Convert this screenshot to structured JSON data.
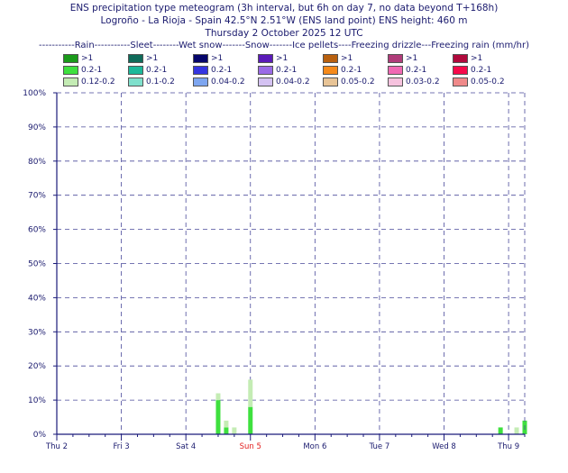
{
  "titles": {
    "line1": "ENS precipitation type meteogram (3h interval, but 6h on day 7, no data beyond T+168h)",
    "line2": "Logroño - La Rioja - Spain 42.5°N 2.51°W (ENS land point) ENS height: 460 m",
    "line3": "Thursday  2 October 2025 12 UTC"
  },
  "legend": {
    "header": "-----------Rain-----------Sleet--------Wet snow-------Snow-------Ice pellets----Freezing drizzle---Freezing rain (mm/hr)",
    "columns": [
      {
        "name": "Rain",
        "items": [
          {
            "label": ">1",
            "color": "#1a9a1a"
          },
          {
            "label": "0.2-1",
            "color": "#3ee03e"
          },
          {
            "label": "0.12-0.2",
            "color": "#c4ecb4"
          }
        ]
      },
      {
        "name": "Sleet",
        "items": [
          {
            "label": ">1",
            "color": "#0f6b5a"
          },
          {
            "label": "0.2-1",
            "color": "#1cb89a"
          },
          {
            "label": "0.1-0.2",
            "color": "#7fe0cc"
          }
        ]
      },
      {
        "name": "Wet snow",
        "items": [
          {
            "label": ">1",
            "color": "#05056b"
          },
          {
            "label": "0.2-1",
            "color": "#3535e0"
          },
          {
            "label": "0.04-0.2",
            "color": "#7ea6f0"
          }
        ]
      },
      {
        "name": "Snow",
        "items": [
          {
            "label": ">1",
            "color": "#5a1ab8"
          },
          {
            "label": "0.2-1",
            "color": "#9a6ae6"
          },
          {
            "label": "0.04-0.2",
            "color": "#d4c2f2"
          }
        ]
      },
      {
        "name": "Ice pellets",
        "items": [
          {
            "label": ">1",
            "color": "#b8600f"
          },
          {
            "label": "0.2-1",
            "color": "#f58a1a"
          },
          {
            "label": "0.05-0.2",
            "color": "#e8c496"
          }
        ]
      },
      {
        "name": "Freezing drizzle",
        "items": [
          {
            "label": ">1",
            "color": "#b03c7a"
          },
          {
            "label": "0.2-1",
            "color": "#f068b4"
          },
          {
            "label": "0.03-0.2",
            "color": "#f6c2de"
          }
        ]
      },
      {
        "name": "Freezing rain",
        "items": [
          {
            "label": ">1",
            "color": "#b00a3c"
          },
          {
            "label": "0.2-1",
            "color": "#f50a4a"
          },
          {
            "label": "0.05-0.2",
            "color": "#f08a8a"
          }
        ]
      }
    ]
  },
  "chart_data": {
    "type": "bar",
    "stacked": true,
    "ylabel": "",
    "ylim": [
      0,
      100
    ],
    "ytick_labels": [
      "0%",
      "10%",
      "20%",
      "30%",
      "40%",
      "50%",
      "60%",
      "70%",
      "80%",
      "90%",
      "100%"
    ],
    "x_unit": "hours since Thu 2 Oct 2025 12 UTC",
    "xlim": [
      0,
      174
    ],
    "day_ticks": [
      {
        "label": "Thu 2",
        "sunday": false
      },
      {
        "label": "Fri 3",
        "sunday": false
      },
      {
        "label": "Sat 4",
        "sunday": false
      },
      {
        "label": "Sun 5",
        "sunday": true
      },
      {
        "label": "Mon 6",
        "sunday": false
      },
      {
        "label": "Tue 7",
        "sunday": false
      },
      {
        "label": "Wed 8",
        "sunday": false
      },
      {
        "label": "Thu 9",
        "sunday": false
      }
    ],
    "grid": true,
    "series": [
      {
        "name": "Rain 0.2-1",
        "color": "#3ee03e",
        "points": [
          {
            "x": 60,
            "y": 10
          },
          {
            "x": 63,
            "y": 2
          },
          {
            "x": 72,
            "y": 8
          },
          {
            "x": 165,
            "y": 2
          },
          {
            "x": 174,
            "y": 4
          }
        ]
      },
      {
        "name": "Rain 0.12-0.2",
        "color": "#c4ecb4",
        "points": [
          {
            "x": 60,
            "y": 2
          },
          {
            "x": 63,
            "y": 2
          },
          {
            "x": 66,
            "y": 2
          },
          {
            "x": 72,
            "y": 8
          },
          {
            "x": 171,
            "y": 2
          }
        ]
      }
    ]
  }
}
